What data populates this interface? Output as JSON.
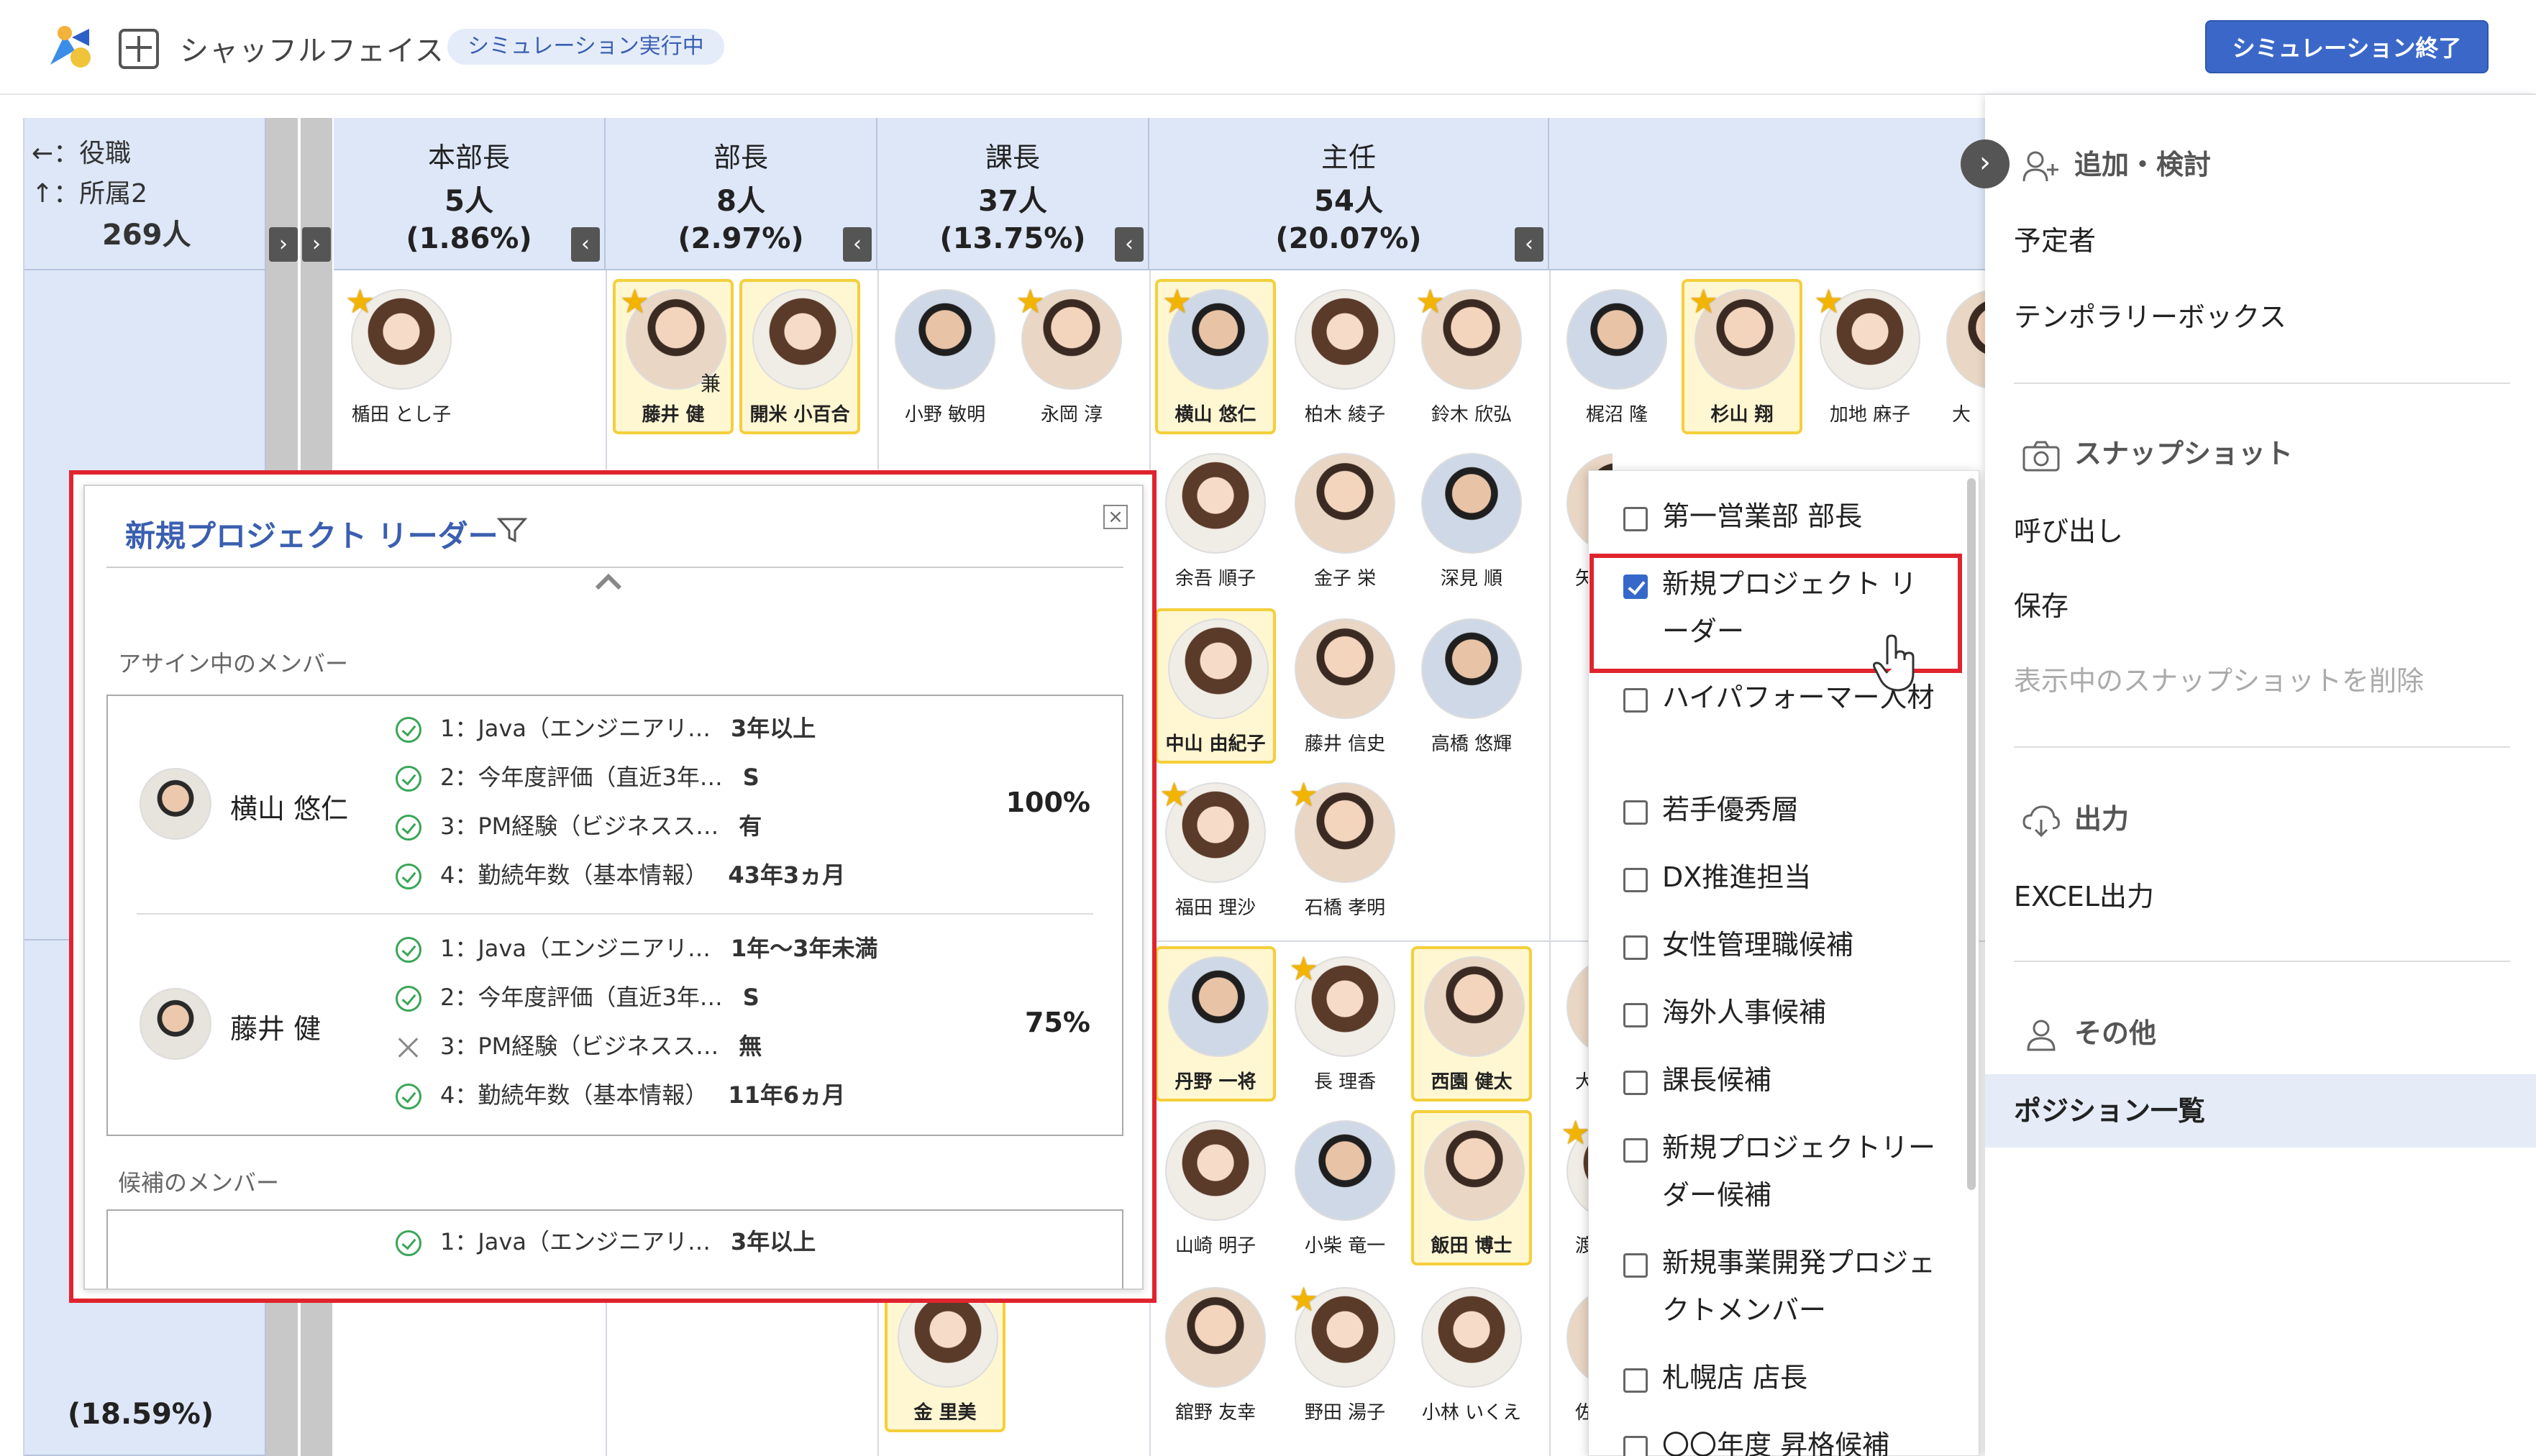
{
  "header": {
    "title": "シャッフルフェイス",
    "status_badge": "シミュレーション実行中",
    "end_button": "シミュレーション終了"
  },
  "grid": {
    "corner": {
      "axis_x": "←：役職",
      "axis_y": "↑：所属2",
      "total": "269人"
    },
    "columns": [
      {
        "title": "本部長",
        "count": "5人",
        "pct": "(1.86%)"
      },
      {
        "title": "部長",
        "count": "8人",
        "pct": "(2.97%)"
      },
      {
        "title": "課長",
        "count": "37人",
        "pct": "(13.75%)"
      },
      {
        "title": "主任",
        "count": "54人",
        "pct": "(20.07%)"
      }
    ],
    "row_pct": "(18.59%)",
    "people": [
      {
        "name": "楯田 とし子"
      },
      {
        "name": "藤井 健",
        "badge": "兼"
      },
      {
        "name": "開米 小百合"
      },
      {
        "name": "小野 敏明"
      },
      {
        "name": "永岡 淳"
      },
      {
        "name": "横山 悠仁"
      },
      {
        "name": "柏木 綾子"
      },
      {
        "name": "鈴木 欣弘"
      },
      {
        "name": "梶沼 隆"
      },
      {
        "name": "杉山 翔"
      },
      {
        "name": "加地 麻子"
      },
      {
        "name": "大"
      },
      {
        "name": "余吾 順子"
      },
      {
        "name": "金子 栄"
      },
      {
        "name": "深見 順"
      },
      {
        "name": "中山 由紀子"
      },
      {
        "name": "藤井 信史"
      },
      {
        "name": "高橋 悠輝"
      },
      {
        "name": "福田 理沙"
      },
      {
        "name": "石橋 孝明"
      },
      {
        "name": "丹野 一将"
      },
      {
        "name": "長 理香"
      },
      {
        "name": "西園 健太"
      },
      {
        "name": "山崎 明子"
      },
      {
        "name": "小柴 竜一"
      },
      {
        "name": "飯田 博士"
      },
      {
        "name": "金 里美"
      },
      {
        "name": "舘野 友幸"
      },
      {
        "name": "野田 湯子"
      },
      {
        "name": "小林 いくえ"
      },
      {
        "name": "矢"
      },
      {
        "name": "大"
      },
      {
        "name": "渡"
      },
      {
        "name": "佐"
      }
    ]
  },
  "popup": {
    "title": "新規プロジェクト リーダー",
    "assigned_label": "アサイン中のメンバー",
    "candidate_label": "候補のメンバー",
    "members": [
      {
        "name": "横山 悠仁",
        "pct": "100%",
        "criteria": [
          {
            "label": "1：Java（エンジニアリ…",
            "value": "3年以上"
          },
          {
            "label": "2：今年度評価（直近3年…",
            "value": "S"
          },
          {
            "label": "3：PM経験（ビジネスス…",
            "value": "有"
          },
          {
            "label": "4：勤続年数（基本情報）",
            "value": "43年3ヵ月"
          }
        ]
      },
      {
        "name": "藤井 健",
        "pct": "75%",
        "criteria": [
          {
            "label": "1：Java（エンジニアリ…",
            "value": "1年～3年未満"
          },
          {
            "label": "2：今年度評価（直近3年…",
            "value": "S"
          },
          {
            "label": "3：PM経験（ビジネスス…",
            "value": "無"
          },
          {
            "label": "4：勤続年数（基本情報）",
            "value": "11年6ヵ月"
          }
        ]
      }
    ],
    "candidate_first": {
      "label": "1：Java（エンジニアリ…",
      "value": "3年以上"
    }
  },
  "dropdown": {
    "items": [
      {
        "label": "第一営業部 部長",
        "checked": false
      },
      {
        "label": "新規プロジェクト リーダー",
        "checked": true
      },
      {
        "label": "ハイパフォーマー人材",
        "checked": false
      },
      {
        "label": "若手優秀層",
        "checked": false
      },
      {
        "label": "DX推進担当",
        "checked": false
      },
      {
        "label": "女性管理職候補",
        "checked": false
      },
      {
        "label": "海外人事候補",
        "checked": false
      },
      {
        "label": "課長候補",
        "checked": false
      },
      {
        "label": "新規プロジェクトリーダー候補",
        "checked": false
      },
      {
        "label": "新規事業開発プロジェクトメンバー",
        "checked": false
      },
      {
        "label": "札幌店 店長",
        "checked": false
      },
      {
        "label": "〇〇年度 昇格候補",
        "checked": false
      }
    ]
  },
  "right_panel": {
    "section_add": "追加・検討",
    "add_items": [
      "予定者",
      "テンポラリーボックス"
    ],
    "section_snapshot": "スナップショット",
    "snapshot_items": [
      "呼び出し",
      "保存",
      "表示中のスナップショットを削除"
    ],
    "section_output": "出力",
    "output_items": [
      "EXCEL出力"
    ],
    "section_other": "その他",
    "other_items": [
      "ポジション一覧"
    ]
  },
  "colors": {
    "accent": "#3b68c8",
    "highlight_border": "#e0242d",
    "star": "#f2b400",
    "card_highlight": "#f4cf3a"
  }
}
